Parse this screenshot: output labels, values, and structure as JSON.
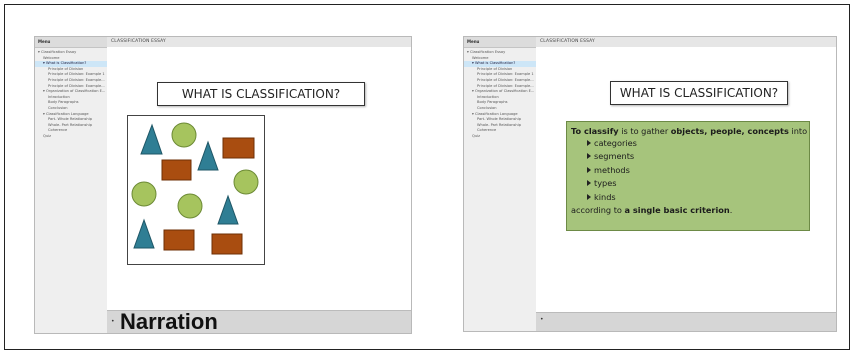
{
  "left_screenshot": {
    "menu": {
      "header": "Menu",
      "items": [
        {
          "label": "Classification Essay",
          "level": 0,
          "active": false,
          "marker": "▾"
        },
        {
          "label": "Welcome",
          "level": 1,
          "active": false
        },
        {
          "label": "What is Classification?",
          "level": 1,
          "active": true,
          "marker": "▾"
        },
        {
          "label": "Principle of Division",
          "level": 2,
          "active": false
        },
        {
          "label": "Principle of Division: Example 1",
          "level": 2,
          "active": false
        },
        {
          "label": "Principle of Division: Example...",
          "level": 2,
          "active": false
        },
        {
          "label": "Principle of Division: Example...",
          "level": 2,
          "active": false
        },
        {
          "label": "Organization of Classification E...",
          "level": 1,
          "active": false,
          "marker": "▾"
        },
        {
          "label": "Introduction",
          "level": 2,
          "active": false
        },
        {
          "label": "Body Paragraphs",
          "level": 2,
          "active": false
        },
        {
          "label": "Conclusion",
          "level": 2,
          "active": false
        },
        {
          "label": "Classification Language",
          "level": 1,
          "active": false,
          "marker": "▾"
        },
        {
          "label": "Part- Whole Relationship",
          "level": 2,
          "active": false
        },
        {
          "label": "Whole- Part Relationship",
          "level": 2,
          "active": false
        },
        {
          "label": "Coherence",
          "level": 2,
          "active": false
        },
        {
          "label": "Quiz",
          "level": 1,
          "active": false
        }
      ]
    },
    "content_title": "CLASSIFICATION ESSAY",
    "slide_title": "WHAT IS CLASSIFICATION?",
    "narration_label": "Narration",
    "bullet_marker": "•"
  },
  "right_screenshot": {
    "menu": {
      "header": "Menu",
      "items": [
        {
          "label": "Classification Essay",
          "level": 0,
          "active": false,
          "marker": "▾"
        },
        {
          "label": "Welcome",
          "level": 1,
          "active": false
        },
        {
          "label": "What is Classification?",
          "level": 1,
          "active": true,
          "marker": "▾"
        },
        {
          "label": "Principle of Division",
          "level": 2,
          "active": false
        },
        {
          "label": "Principle of Division: Example 1",
          "level": 2,
          "active": false
        },
        {
          "label": "Principle of Division: Example...",
          "level": 2,
          "active": false
        },
        {
          "label": "Principle of Division: Example...",
          "level": 2,
          "active": false
        },
        {
          "label": "Organization of Classification E...",
          "level": 1,
          "active": false,
          "marker": "▾"
        },
        {
          "label": "Introduction",
          "level": 2,
          "active": false
        },
        {
          "label": "Body Paragraphs",
          "level": 2,
          "active": false
        },
        {
          "label": "Conclusion",
          "level": 2,
          "active": false
        },
        {
          "label": "Classification Language",
          "level": 1,
          "active": false,
          "marker": "▾"
        },
        {
          "label": "Part- Whole Relationship",
          "level": 2,
          "active": false
        },
        {
          "label": "Whole- Part Relationship",
          "level": 2,
          "active": false
        },
        {
          "label": "Coherence",
          "level": 2,
          "active": false
        },
        {
          "label": "Quiz",
          "level": 1,
          "active": false
        }
      ]
    },
    "content_title": "CLASSIFICATION ESSAY",
    "slide_title": "WHAT IS CLASSIFICATION?",
    "definition": {
      "lead_bold": "To classify",
      "lead_mid": " is to gather ",
      "lead_bold2": "objects, people, concepts",
      "lead_end": " into",
      "bullets": [
        "categories",
        "segments",
        "methods",
        "types",
        "kinds"
      ],
      "foot_pre": "according to ",
      "foot_bold": "a single basic criterion",
      "foot_end": "."
    },
    "bullet_marker": "•"
  },
  "colors": {
    "triangle": "#2f7e94",
    "circle": "#a6c45e",
    "rectangle": "#a94d10",
    "definition_box": "#a6c47c",
    "menu_active": "#cde6f7"
  }
}
